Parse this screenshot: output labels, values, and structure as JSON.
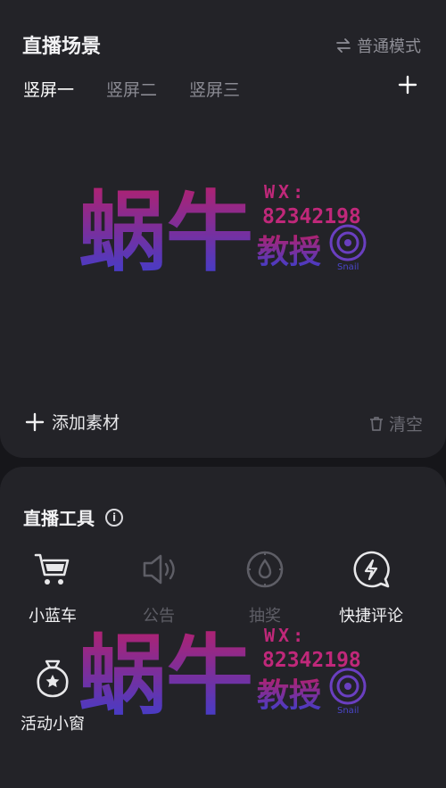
{
  "scene": {
    "title": "直播场景",
    "mode_label": "普通模式",
    "tabs": [
      {
        "label": "竖屏一",
        "active": true
      },
      {
        "label": "竖屏二",
        "active": false
      },
      {
        "label": "竖屏三",
        "active": false
      }
    ],
    "add_material_label": "添加素材",
    "clear_label": "清空"
  },
  "tools": {
    "title": "直播工具",
    "info_glyph": "i",
    "items": [
      {
        "label": "小蓝车",
        "icon": "cart-icon",
        "enabled": true
      },
      {
        "label": "公告",
        "icon": "speaker-icon",
        "enabled": false
      },
      {
        "label": "抽奖",
        "icon": "lottery-icon",
        "enabled": false
      },
      {
        "label": "快捷评论",
        "icon": "quick-comment-icon",
        "enabled": true
      },
      {
        "label": "活动小窗",
        "icon": "activity-bag-icon",
        "enabled": true
      }
    ]
  },
  "watermark": {
    "brand": "蜗牛",
    "sub": "教授",
    "wx_label": "WX:",
    "wx_number": "82342198",
    "tag": "Snail"
  },
  "colors": {
    "panel": "#232328",
    "background": "#16161a",
    "watermark_top": "#b3216e",
    "watermark_bottom": "#3a3fd0"
  }
}
